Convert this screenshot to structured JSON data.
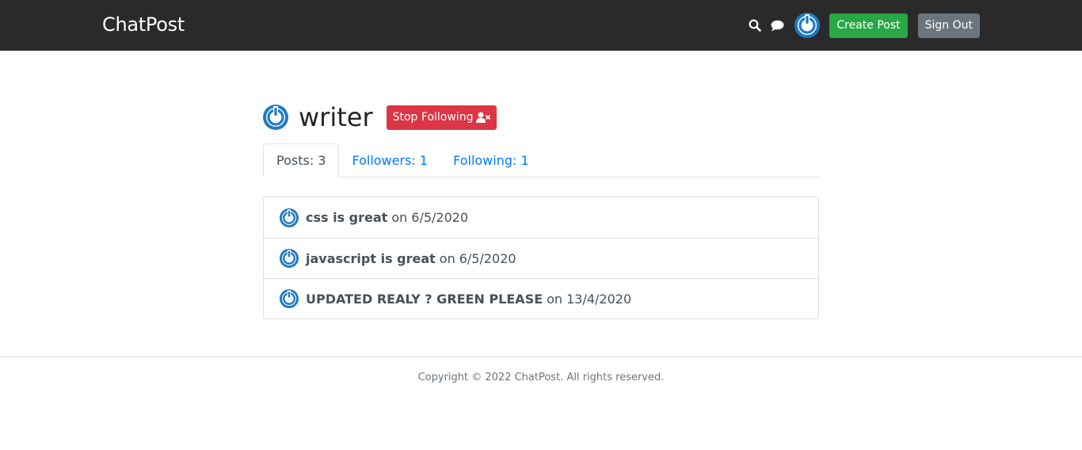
{
  "navbar": {
    "brand": "ChatPost",
    "search_icon": "search-icon",
    "chat_icon": "chat-icon",
    "create_post_label": "Create Post",
    "sign_out_label": "Sign Out"
  },
  "profile": {
    "username": "writer",
    "stop_following_label": "Stop Following",
    "stop_following_icon": "user-times-icon"
  },
  "tabs": [
    {
      "label": "Posts: 3",
      "active": true
    },
    {
      "label": "Followers: 1",
      "active": false
    },
    {
      "label": "Following: 1",
      "active": false
    }
  ],
  "posts": [
    {
      "title": "css is great",
      "on": "on",
      "date": "6/5/2020"
    },
    {
      "title": "javascript is great",
      "on": "on",
      "date": "6/5/2020"
    },
    {
      "title": "UPDATED REALY ? GREEN PLEASE",
      "on": "on",
      "date": "13/4/2020"
    }
  ],
  "footer": {
    "copyright": "Copyright © 2022 ChatPost. All rights reserved."
  },
  "colors": {
    "navbar_bg": "#2a2a2a",
    "avatar_blue": "#1e7bc4",
    "green": "#28a745",
    "red": "#dc3545",
    "gray": "#6c757d",
    "link": "#007bff"
  }
}
